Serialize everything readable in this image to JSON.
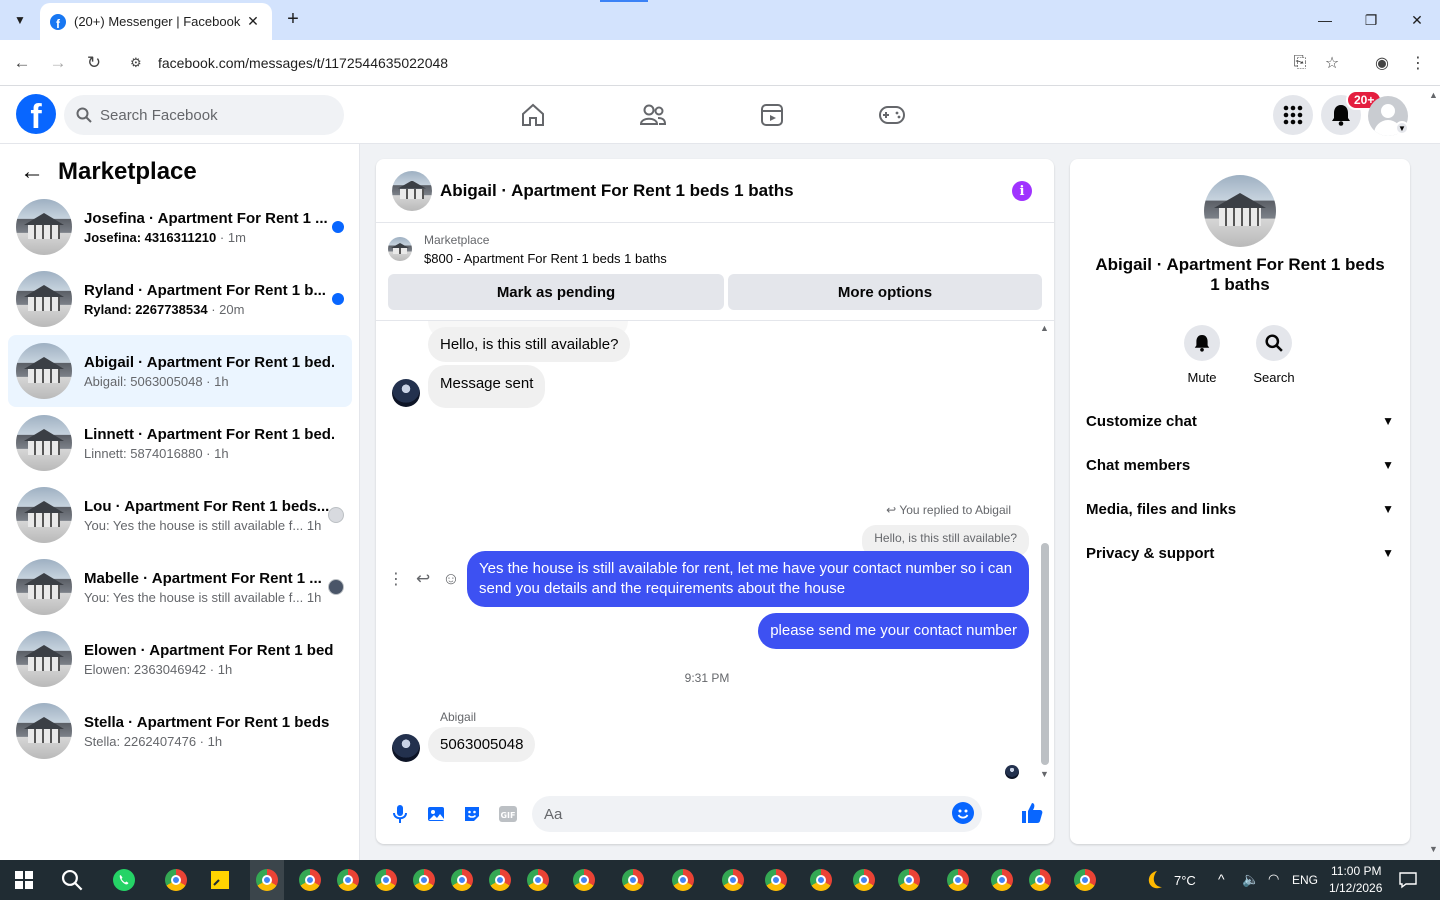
{
  "browser": {
    "tab_title": "(20+) Messenger | Facebook",
    "url": "facebook.com/messages/t/1172544635022048"
  },
  "fb": {
    "search_placeholder": "Search Facebook",
    "notif_badge": "20+"
  },
  "sidebar": {
    "title": "Marketplace",
    "conversations": [
      {
        "name": "Josefina · Apartment For Rent 1 ...",
        "preview": "Josefina: 4316311210",
        "time": "1m",
        "unread": true
      },
      {
        "name": "Ryland · Apartment For Rent 1 b...",
        "preview": "Ryland: 2267738534",
        "time": "20m",
        "unread": true
      },
      {
        "name": "Abigail · Apartment For Rent 1 bed...",
        "preview": "Abigail: 5063005048",
        "time": "1h",
        "unread": false
      },
      {
        "name": "Linnett · Apartment For Rent 1 bed...",
        "preview": "Linnett: 5874016880",
        "time": "1h",
        "unread": false
      },
      {
        "name": "Lou · Apartment For Rent 1 beds...",
        "preview": "You: Yes the house is still available f...",
        "time": "1h",
        "unread": false
      },
      {
        "name": "Mabelle · Apartment For Rent 1 ...",
        "preview": "You: Yes the house is still available f...",
        "time": "1h",
        "unread": false
      },
      {
        "name": "Elowen · Apartment For Rent 1 bed...",
        "preview": "Elowen: 2363046942",
        "time": "1h",
        "unread": false
      },
      {
        "name": "Stella · Apartment For Rent 1 beds ...",
        "preview": "Stella: 2262407476",
        "time": "1h",
        "unread": false
      }
    ]
  },
  "chat": {
    "title": "Abigail · Apartment For Rent 1 beds 1 baths",
    "marketplace_label": "Marketplace",
    "listing": "$800 - Apartment For Rent 1 beds 1 baths",
    "mark_pending": "Mark as pending",
    "more_options": "More options",
    "messages": {
      "in_1": "Hello, is this still available?",
      "in_2": "Message sent",
      "reply_note": "You replied to Abigail",
      "quoted": "Hello, is this still available?",
      "out_1": "Yes the house is still available for rent, let me have your contact number so i can send you details and the requirements about the house",
      "out_2": "please send me your contact number",
      "timestamp": "9:31 PM",
      "sender": "Abigail",
      "in_3": "5063005048"
    },
    "composer_placeholder": "Aa"
  },
  "right_panel": {
    "name": "Abigail · Apartment For Rent 1 beds 1 baths",
    "mute": "Mute",
    "search": "Search",
    "sections": [
      "Customize chat",
      "Chat members",
      "Media, files and links",
      "Privacy & support"
    ]
  },
  "taskbar": {
    "weather": "7°C",
    "lang": "ENG",
    "time": "11:00 PM",
    "date": "1/12/2026"
  },
  "colors": {
    "accent": "#0866ff",
    "outgoing_bubble": "#3d51f2",
    "active_row": "#ebf5ff"
  }
}
